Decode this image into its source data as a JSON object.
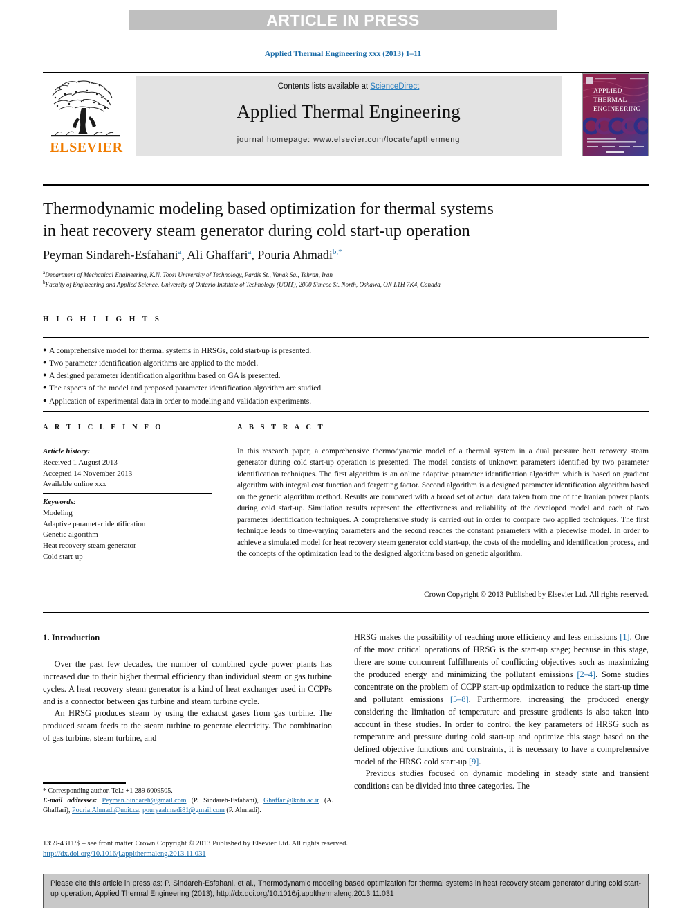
{
  "banner": {
    "text": "ARTICLE IN PRESS"
  },
  "journal_ref": "Applied Thermal Engineering xxx (2013) 1–11",
  "masthead": {
    "contents_prefix": "Contents lists available at ",
    "sciencedirect": "ScienceDirect",
    "journal_title": "Applied Thermal Engineering",
    "homepage": "journal homepage: www.elsevier.com/locate/apthermeng",
    "publisher_wordmark": "ELSEVIER",
    "cover_line1": "APPLIED",
    "cover_line2": "THERMAL",
    "cover_line3": "ENGINEERING"
  },
  "article": {
    "title_line1": "Thermodynamic modeling based optimization for thermal systems",
    "title_line2": "in heat recovery steam generator during cold start-up operation",
    "authors": [
      {
        "name": "Peyman Sindareh-Esfahani",
        "marks": "a"
      },
      {
        "name": "Ali Ghaffari",
        "marks": "a"
      },
      {
        "name": "Pouria Ahmadi",
        "marks": "b,*"
      }
    ],
    "affiliations": [
      {
        "mark": "a",
        "text": "Department of Mechanical Engineering, K.N. Toosi University of Technology, Pardis St., Vanak Sq., Tehran, Iran"
      },
      {
        "mark": "b",
        "text": "Faculty of Engineering and Applied Science, University of Ontario Institute of Technology (UOIT), 2000 Simcoe St. North, Oshawa, ON L1H 7K4, Canada"
      }
    ]
  },
  "highlights": {
    "heading": "H I G H L I G H T S",
    "items": [
      "A comprehensive model for thermal systems in HRSGs, cold start-up is presented.",
      "Two parameter identification algorithms are applied to the model.",
      "A designed parameter identification algorithm based on GA is presented.",
      "The aspects of the model and proposed parameter identification algorithm are studied.",
      "Application of experimental data in order to modeling and validation experiments."
    ]
  },
  "article_info": {
    "heading": "A R T I C L E  I N F O",
    "history_label": "Article history:",
    "history": [
      "Received 1 August 2013",
      "Accepted 14 November 2013",
      "Available online xxx"
    ],
    "keywords_label": "Keywords:",
    "keywords": [
      "Modeling",
      "Adaptive parameter identification",
      "Genetic algorithm",
      "Heat recovery steam generator",
      "Cold start-up"
    ]
  },
  "abstract": {
    "heading": "A B S T R A C T",
    "text": "In this research paper, a comprehensive thermodynamic model of a thermal system in a dual pressure heat recovery steam generator during cold start-up operation is presented. The model consists of unknown parameters identified by two parameter identification techniques. The first algorithm is an online adaptive parameter identification algorithm which is based on gradient algorithm with integral cost function and forgetting factor. Second algorithm is a designed parameter identification algorithm based on the genetic algorithm method. Results are compared with a broad set of actual data taken from one of the Iranian power plants during cold start-up. Simulation results represent the effectiveness and reliability of the developed model and each of two parameter identification techniques. A comprehensive study is carried out in order to compare two applied techniques. The first technique leads to time-varying parameters and the second reaches the constant parameters with a piecewise model. In order to achieve a simulated model for heat recovery steam generator cold start-up, the costs of the modeling and identification process, and the concepts of the optimization lead to the designed algorithm based on genetic algorithm.",
    "copyright": "Crown Copyright © 2013 Published by Elsevier Ltd. All rights reserved."
  },
  "body": {
    "section_heading": "1. Introduction",
    "left_paragraphs": [
      "Over the past few decades, the number of combined cycle power plants has increased due to their higher thermal efficiency than individual steam or gas turbine cycles. A heat recovery steam generator is a kind of heat exchanger used in CCPPs and is a connector between gas turbine and steam turbine cycle.",
      "An HRSG produces steam by using the exhaust gases from gas turbine. The produced steam feeds to the steam turbine to generate electricity. The combination of gas turbine, steam turbine, and"
    ],
    "right_paragraphs": [
      "HRSG makes the possibility of reaching more efficiency and less emissions [1]. One of the most critical operations of HRSG is the start-up stage; because in this stage, there are some concurrent fulfillments of conflicting objectives such as maximizing the produced energy and minimizing the pollutant emissions [2–4]. Some studies concentrate on the problem of CCPP start-up optimization to reduce the start-up time and pollutant emissions [5–8]. Furthermore, increasing the produced energy considering the limitation of temperature and pressure gradients is also taken into account in these studies. In order to control the key parameters of HRSG such as temperature and pressure during cold start-up and optimize this stage based on the defined objective functions and constraints, it is necessary to have a comprehensive model of the HRSG cold start-up [9].",
      "Previous studies focused on dynamic modeling in steady state and transient conditions can be divided into three categories. The"
    ]
  },
  "footnote": {
    "corresponding": "* Corresponding author. Tel.: +1 289 6009505.",
    "email_label": "E-mail addresses:",
    "emails": [
      {
        "address": "Peyman.Sindareh@gmail.com",
        "owner": "(P. Sindareh-Esfahani)"
      },
      {
        "address": "Ghaffari@kntu.ac.ir",
        "owner": "(A. Ghaffari)"
      },
      {
        "address": "Pouria.Ahmadi@uoit.ca",
        "owner": ""
      },
      {
        "address": "pouryaahmadi81@gmail.com",
        "owner": "(P. Ahmadi)"
      }
    ]
  },
  "imprint": {
    "line1": "1359-4311/$ – see front matter Crown Copyright © 2013 Published by Elsevier Ltd. All rights reserved.",
    "doi": "http://dx.doi.org/10.1016/j.applthermaleng.2013.11.031"
  },
  "cite_box": {
    "text": "Please cite this article in press as: P. Sindareh-Esfahani, et al., Thermodynamic modeling based optimization for thermal systems in heat recovery steam generator during cold start-up operation, Applied Thermal Engineering (2013), http://dx.doi.org/10.1016/j.applthermaleng.2013.11.031"
  },
  "colors": {
    "link": "#1b6ca8",
    "banner_bg": "#bfbfbf",
    "contents_bg": "#e3e3e3",
    "elsevier_orange": "#f07c00",
    "cite_bg": "#c8c8c8"
  }
}
